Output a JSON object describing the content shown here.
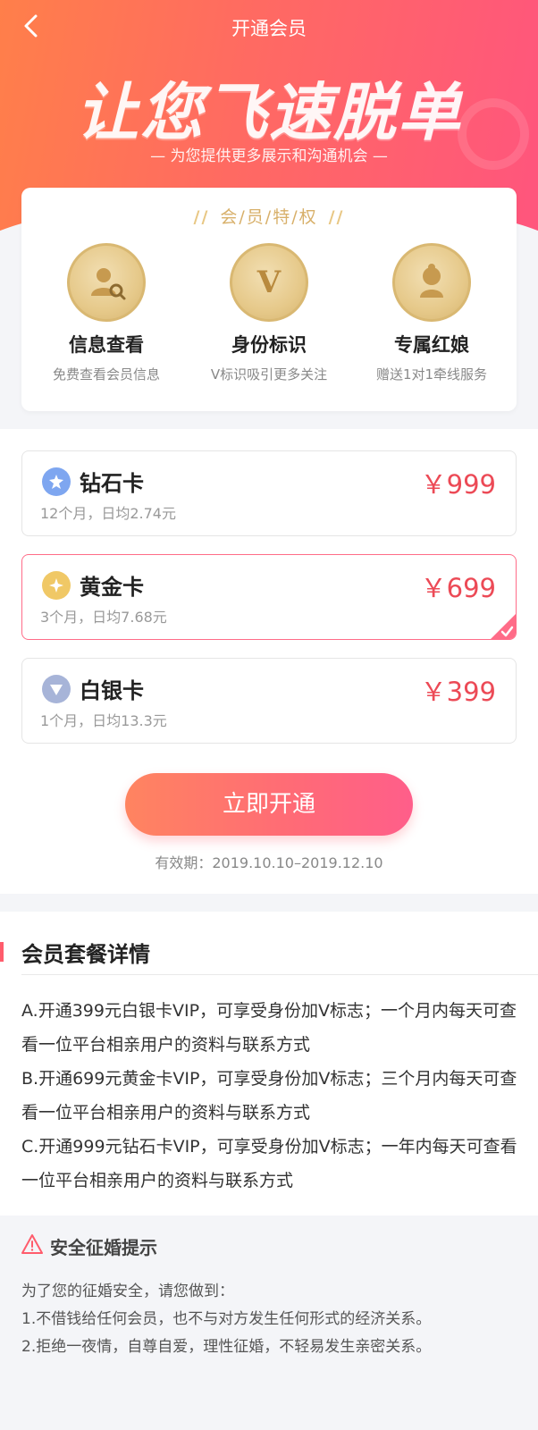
{
  "header": {
    "title": "开通会员",
    "slogan": "让您飞速脱单",
    "subtitle": "— 为您提供更多展示和沟通机会 —"
  },
  "privileges": {
    "title": "会/员/特/权",
    "items": [
      {
        "label": "信息查看",
        "desc": "免费查看会员信息",
        "icon": "person-search-icon"
      },
      {
        "label": "身份标识",
        "desc": "V标识吸引更多关注",
        "icon": "v-badge-icon"
      },
      {
        "label": "专属红娘",
        "desc": "赠送1对1牵线服务",
        "icon": "matchmaker-icon"
      }
    ]
  },
  "plans": [
    {
      "name": "钻石卡",
      "sub": "12个月，日均2.74元",
      "price": "￥999",
      "selected": false,
      "icon": "diamond-icon"
    },
    {
      "name": "黄金卡",
      "sub": "3个月，日均7.68元",
      "price": "￥699",
      "selected": true,
      "icon": "gold-star-icon"
    },
    {
      "name": "白银卡",
      "sub": "1个月，日均13.3元",
      "price": "￥399",
      "selected": false,
      "icon": "silver-icon"
    }
  ],
  "cta": {
    "label": "立即开通",
    "validity": "有效期：2019.10.10–2019.12.10"
  },
  "details": {
    "title": "会员套餐详情",
    "lines": [
      "A.开通399元白银卡VIP，可享受身份加V标志；一个月内每天可查看一位平台相亲用户的资料与联系方式",
      "B.开通699元黄金卡VIP，可享受身份加V标志；三个月内每天可查看一位平台相亲用户的资料与联系方式",
      "C.开通999元钻石卡VIP，可享受身份加V标志；一年内每天可查看一位平台相亲用户的资料与联系方式"
    ]
  },
  "safety": {
    "title": "安全征婚提示",
    "lines": [
      "为了您的征婚安全，请您做到：",
      "1.不借钱给任何会员，也不与对方发生任何形式的经济关系。",
      "2.拒绝一夜情，自尊自爱，理性征婚，不轻易发生亲密关系。"
    ]
  },
  "colors": {
    "accent": "#ff5e7a",
    "price": "#ec4a56",
    "gold": "#d9b872"
  }
}
